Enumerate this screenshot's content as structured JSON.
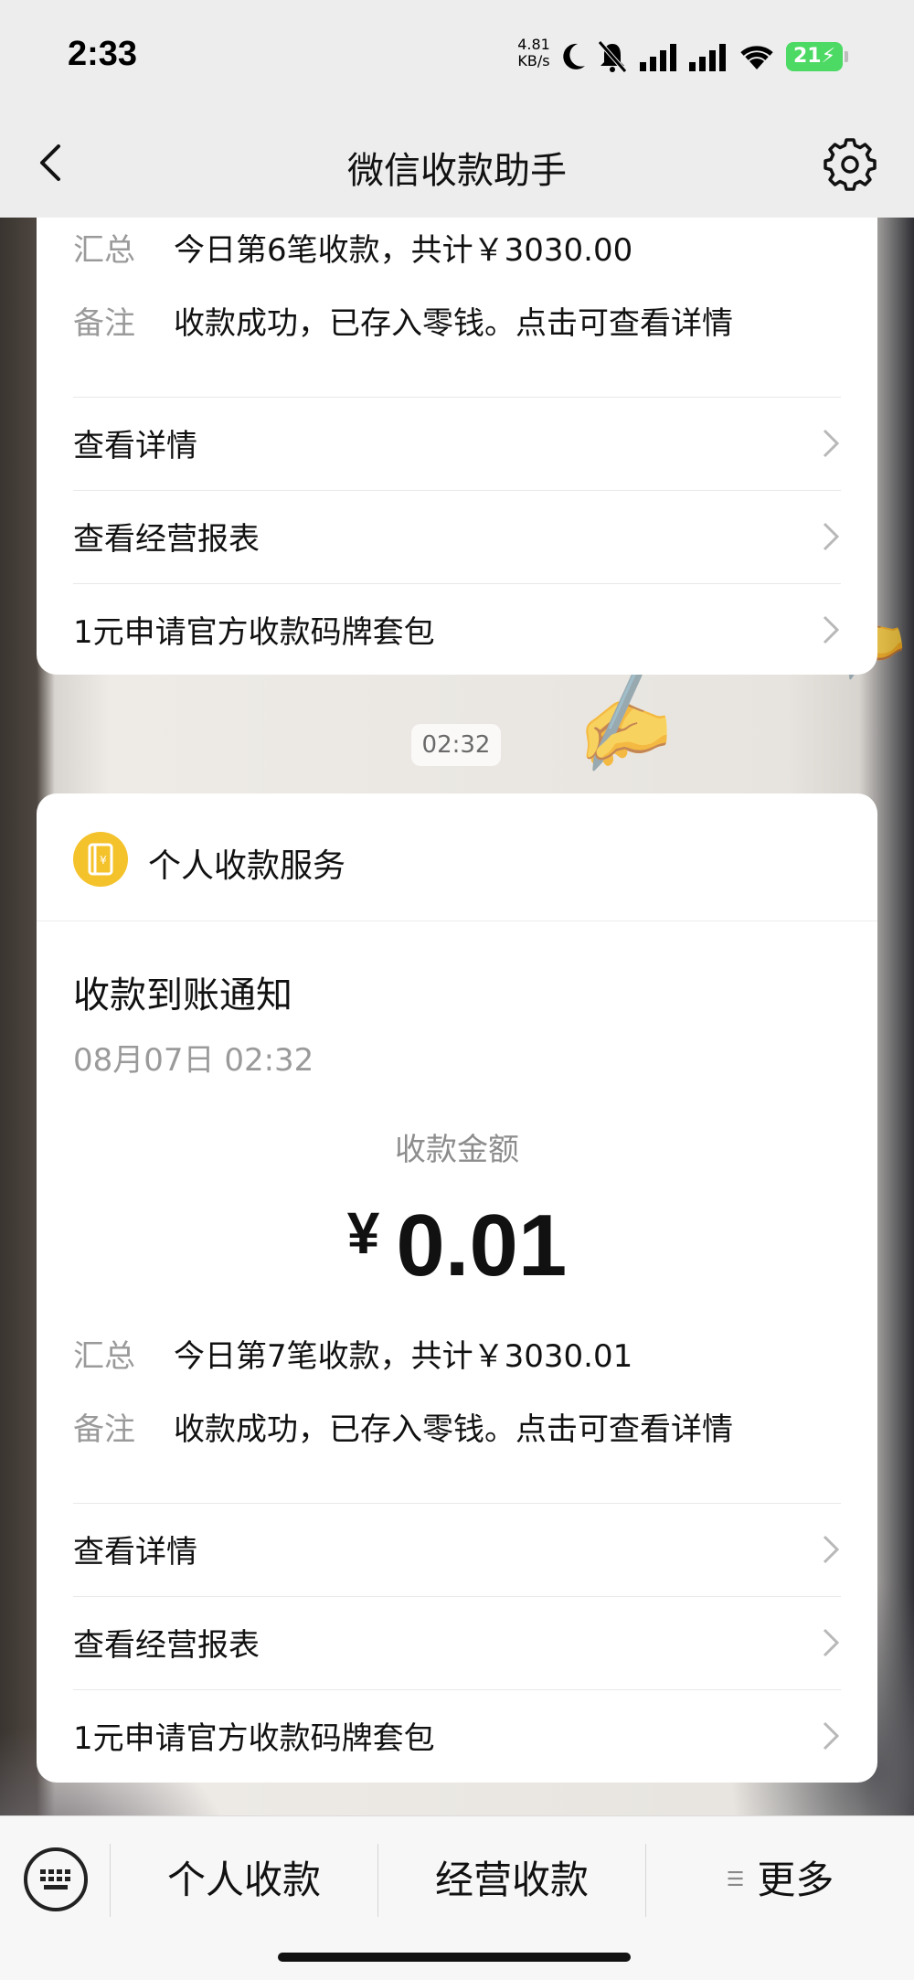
{
  "status_bar": {
    "time": "2:33",
    "net_speed_value": "4.81",
    "net_speed_unit": "KB/s",
    "battery": "21"
  },
  "nav": {
    "title": "微信收款助手"
  },
  "card_previous": {
    "summary_label": "汇总",
    "summary_value": "今日第6笔收款，共计￥3030.00",
    "remark_label": "备注",
    "remark_value": "收款成功，已存入零钱。点击可查看详情",
    "links": [
      "查看详情",
      "查看经营报表",
      "1元申请官方收款码牌套包"
    ]
  },
  "timestamp": "02:32",
  "card_current": {
    "service_name": "个人收款服务",
    "notice_title": "收款到账通知",
    "notice_time": "08月07日 02:32",
    "amount_label": "收款金额",
    "currency": "¥",
    "amount": "0.01",
    "summary_label": "汇总",
    "summary_value": "今日第7笔收款，共计￥3030.01",
    "remark_label": "备注",
    "remark_value": "收款成功，已存入零钱。点击可查看详情",
    "links": [
      "查看详情",
      "查看经营报表",
      "1元申请官方收款码牌套包"
    ]
  },
  "bottom_menu": {
    "items": [
      "个人收款",
      "经营收款",
      "更多"
    ]
  },
  "colors": {
    "service_logo": "#f4c22b",
    "battery": "#4cd964"
  }
}
